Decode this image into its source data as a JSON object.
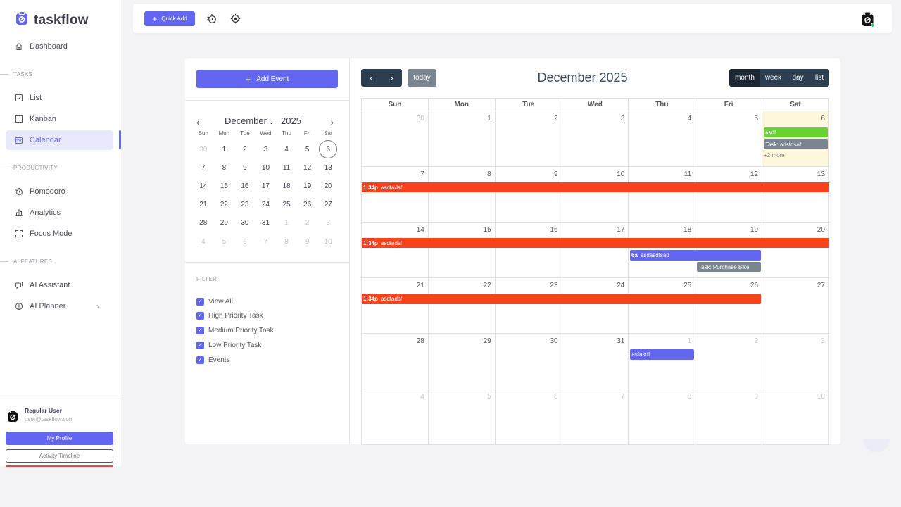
{
  "app": {
    "name": "taskflow"
  },
  "sidebar": {
    "items": [
      {
        "label": "Dashboard",
        "icon": "home-icon"
      },
      {
        "label": "List",
        "icon": "checkbox-icon"
      },
      {
        "label": "Kanban",
        "icon": "grid-icon"
      },
      {
        "label": "Calendar",
        "icon": "calendar-icon",
        "active": true
      },
      {
        "label": "Pomodoro",
        "icon": "timer-icon"
      },
      {
        "label": "Analytics",
        "icon": "bar-chart-icon"
      },
      {
        "label": "Focus Mode",
        "icon": "focus-frame-icon"
      },
      {
        "label": "AI Assistant",
        "icon": "chat-icon"
      },
      {
        "label": "AI Planner",
        "icon": "compass-icon"
      }
    ],
    "sections": {
      "tasks": "TASKS",
      "productivity": "PRODUCTIVITY",
      "ai": "AI FEATURES"
    },
    "chevron": "›"
  },
  "user": {
    "name": "Regular User",
    "email": "user@taskflow.com",
    "profile_label": "My Profile",
    "timeline_label": "Activity Timeline"
  },
  "topbar": {
    "quick_add_label": "Quick Add"
  },
  "calendar_panel": {
    "add_event_label": "Add Event",
    "mini": {
      "month": "December",
      "year": "2025",
      "dow": [
        "Sun",
        "Mon",
        "Tue",
        "Wed",
        "Thu",
        "Fri",
        "Sat"
      ],
      "weeks": [
        [
          "30",
          "1",
          "2",
          "3",
          "4",
          "5",
          "6"
        ],
        [
          "7",
          "8",
          "9",
          "10",
          "11",
          "12",
          "13"
        ],
        [
          "14",
          "15",
          "16",
          "17",
          "18",
          "19",
          "20"
        ],
        [
          "21",
          "22",
          "23",
          "24",
          "25",
          "26",
          "27"
        ],
        [
          "28",
          "29",
          "30",
          "31",
          "1",
          "2",
          "3"
        ],
        [
          "4",
          "5",
          "6",
          "7",
          "8",
          "9",
          "10"
        ]
      ]
    },
    "filter": {
      "label": "FILTER",
      "items": [
        "View All",
        "High Priority Task",
        "Medium Priority Task",
        "Low Priority Task",
        "Events"
      ]
    }
  },
  "calendar": {
    "title": "December 2025",
    "today_label": "today",
    "views": [
      "month",
      "week",
      "day",
      "list"
    ],
    "selected_view": "month",
    "dow": [
      "Sun",
      "Mon",
      "Tue",
      "Wed",
      "Thu",
      "Fri",
      "Sat"
    ],
    "weeks": [
      [
        "30",
        "1",
        "2",
        "3",
        "4",
        "5",
        "6"
      ],
      [
        "7",
        "8",
        "9",
        "10",
        "11",
        "12",
        "13"
      ],
      [
        "14",
        "15",
        "16",
        "17",
        "18",
        "19",
        "20"
      ],
      [
        "21",
        "22",
        "23",
        "24",
        "25",
        "26",
        "27"
      ],
      [
        "28",
        "29",
        "30",
        "31",
        "1",
        "2",
        "3"
      ],
      [
        "4",
        "5",
        "6",
        "7",
        "8",
        "9",
        "10"
      ]
    ],
    "events": {
      "sat6_a": "asdf",
      "sat6_b": "Task: adsfdsaf",
      "sat6_more": "+2 more",
      "w2_time": "1:34p",
      "w2_title": "asdfadsf",
      "w3_time": "1:34p",
      "w3_title": "asdfadsf",
      "w3b_time": "6a",
      "w3b_title": "asdasdfsad",
      "w3c_title": "Task: Purchase Bike",
      "w4_time": "1:34p",
      "w4_title": "asdfadsf",
      "w5_title": "asfasdf"
    }
  },
  "colors": {
    "accent": "#6366f1",
    "event_red": "#f7421e",
    "event_green": "#67d32f",
    "event_gray": "#7b8590",
    "nav_dark": "#2c3e50",
    "today_highlight": "#fdf8dc"
  }
}
